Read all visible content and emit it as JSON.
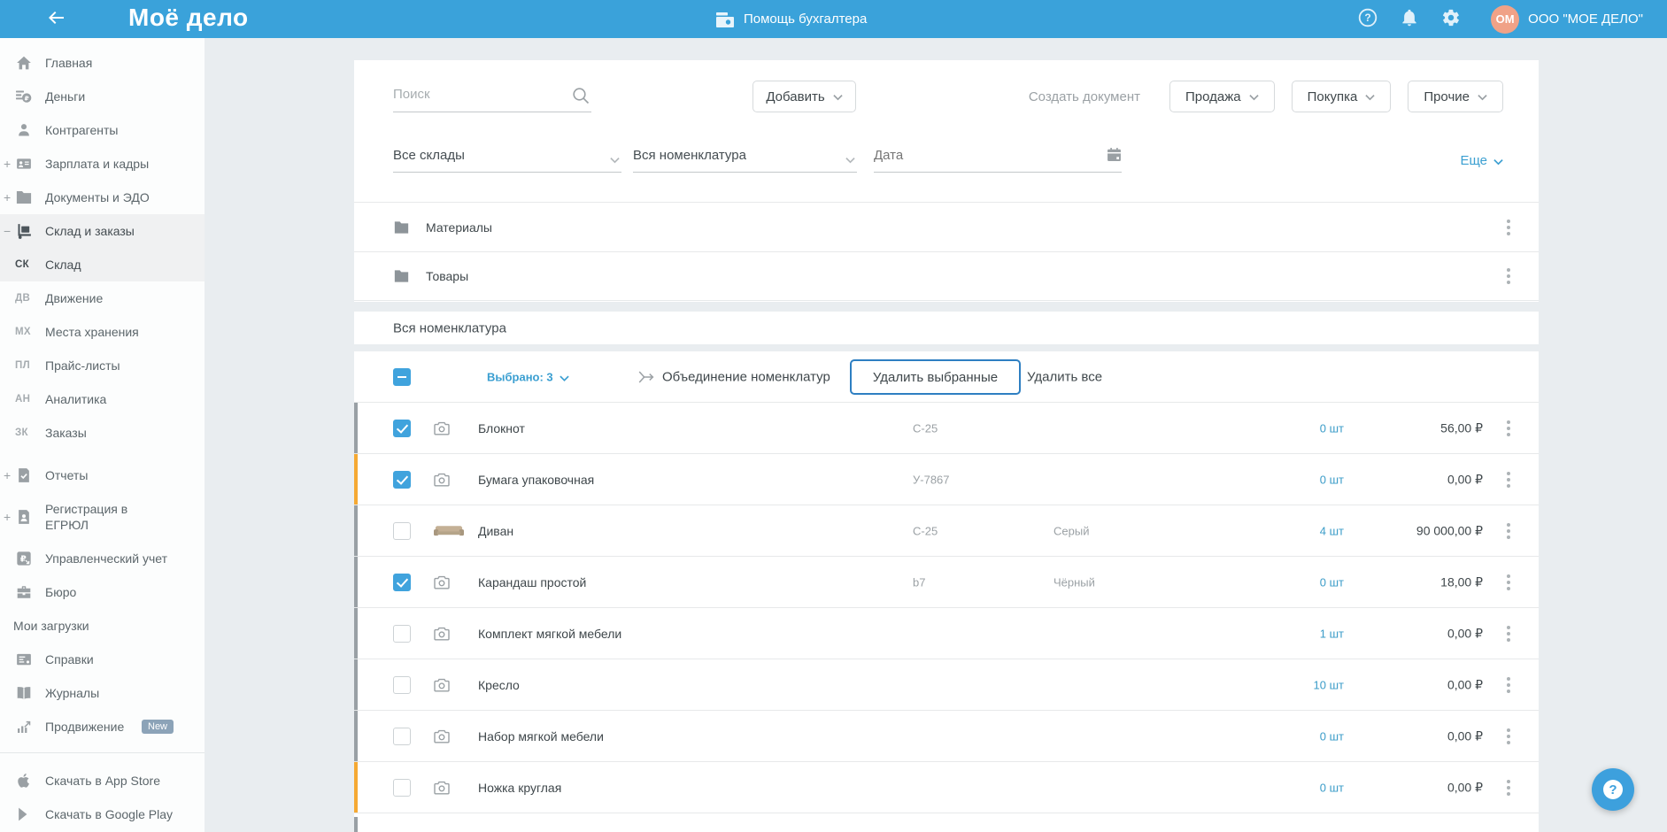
{
  "topbar": {
    "logo": "Моё дело",
    "help_center_label": "Помощь бухгалтера",
    "company": "ООО \"МОЕ ДЕЛО\"",
    "avatar_initials": "ОМ",
    "colors": {
      "bar": "#3aa2da",
      "avatar": "#f0a287"
    }
  },
  "sidebar": {
    "items": [
      {
        "name": "home",
        "label": "Главная",
        "icon": "home"
      },
      {
        "name": "money",
        "label": "Деньги",
        "icon": "money"
      },
      {
        "name": "contractors",
        "label": "Контрагенты",
        "icon": "person"
      },
      {
        "name": "payroll",
        "label": "Зарплата и кадры",
        "icon": "idcard",
        "marker": "+"
      },
      {
        "name": "documents",
        "label": "Документы и ЭДО",
        "icon": "folder",
        "marker": "+"
      },
      {
        "name": "warehouse",
        "label": "Склад и заказы",
        "icon": "handtruck",
        "marker": "−",
        "parent_active": true
      },
      {
        "name": "sklad",
        "label": "Склад",
        "code": "СК",
        "active": true
      },
      {
        "name": "movement",
        "label": "Движение",
        "code": "ДВ"
      },
      {
        "name": "storage",
        "label": "Места хранения",
        "code": "МХ"
      },
      {
        "name": "pricelists",
        "label": "Прайс-листы",
        "code": "ПЛ"
      },
      {
        "name": "analytics",
        "label": "Аналитика",
        "code": "АН"
      },
      {
        "name": "orders",
        "label": "Заказы",
        "code": "ЗК"
      },
      {
        "name": "reports",
        "label": "Отчеты",
        "icon": "doc-check",
        "marker": "+",
        "gap_before": true
      },
      {
        "name": "egrul",
        "label": "Регистрация в ЕГРЮЛ",
        "icon": "doc-person",
        "marker": "+",
        "two_line": true
      },
      {
        "name": "management",
        "label": "Управленческий учет",
        "icon": "ruble-square"
      },
      {
        "name": "bureau",
        "label": "Бюро",
        "icon": "briefcase"
      },
      {
        "name": "downloads",
        "label": "Мои загрузки",
        "no_icon": true
      },
      {
        "name": "certificates",
        "label": "Справки",
        "icon": "list-card"
      },
      {
        "name": "journals",
        "label": "Журналы",
        "icon": "book"
      },
      {
        "name": "promotion",
        "label": "Продвижение",
        "icon": "chart-up",
        "badge": "New"
      },
      {
        "name": "app-store",
        "label": "Скачать в App Store",
        "icon": "apple",
        "divider_before": true
      },
      {
        "name": "google-play",
        "label": "Скачать в Google Play",
        "icon": "google-play"
      }
    ]
  },
  "main": {
    "search_placeholder": "Поиск",
    "add_button": "Добавить",
    "create_doc_label": "Создать документ",
    "doc_buttons": [
      "Продажа",
      "Покупка",
      "Прочие"
    ],
    "filters": {
      "warehouse": "Все склады",
      "nomenclature": "Вся номенклатура",
      "date_placeholder": "Дата"
    },
    "more_link": "Еще",
    "folders": [
      "Материалы",
      "Товары"
    ],
    "section_title": "Вся номенклатура",
    "toolbar": {
      "selected_label": "Выбрано: 3",
      "merge_label": "Объединение номенклатур",
      "delete_selected": "Удалить выбранные",
      "delete_all": "Удалить все"
    },
    "rows": [
      {
        "name": "Блокнот",
        "article": "С-25",
        "color": "",
        "qty": "0 шт",
        "price": "56,00 ₽",
        "checked": true,
        "stripe": "gray",
        "photo": "camera"
      },
      {
        "name": "Бумага упаковочная",
        "article": "У-7867",
        "color": "",
        "qty": "0 шт",
        "price": "0,00 ₽",
        "checked": true,
        "stripe": "orange",
        "photo": "camera"
      },
      {
        "name": "Диван",
        "article": "С-25",
        "color": "Серый",
        "qty": "4 шт",
        "price": "90 000,00 ₽",
        "checked": false,
        "stripe": "gray",
        "photo": "sofa"
      },
      {
        "name": "Карандаш простой",
        "article": "b7",
        "color": "Чёрный",
        "qty": "0 шт",
        "price": "18,00 ₽",
        "checked": true,
        "stripe": "gray",
        "photo": "camera"
      },
      {
        "name": "Комплект мягкой мебели",
        "article": "",
        "color": "",
        "qty": "1 шт",
        "price": "0,00 ₽",
        "checked": false,
        "stripe": "gray",
        "photo": "camera"
      },
      {
        "name": "Кресло",
        "article": "",
        "color": "",
        "qty": "10 шт",
        "price": "0,00 ₽",
        "checked": false,
        "stripe": "gray",
        "photo": "camera"
      },
      {
        "name": "Набор мягкой мебели",
        "article": "",
        "color": "",
        "qty": "0 шт",
        "price": "0,00 ₽",
        "checked": false,
        "stripe": "gray",
        "photo": "camera"
      },
      {
        "name": "Ножка круглая",
        "article": "",
        "color": "",
        "qty": "0 шт",
        "price": "0,00 ₽",
        "checked": false,
        "stripe": "orange",
        "photo": "camera"
      }
    ],
    "colors": {
      "accent_blue": "#3b9fd1",
      "checkbox_blue": "#40a3dd",
      "stripe_orange": "#f5a933",
      "stripe_gray": "#99a0a5"
    }
  },
  "float_help": {
    "label": "?"
  }
}
